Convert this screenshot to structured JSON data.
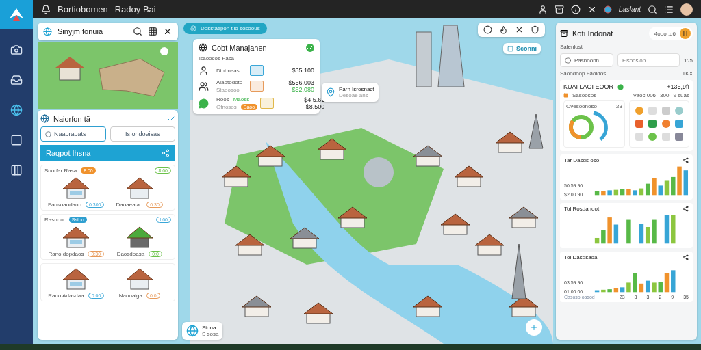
{
  "app": {
    "title": "Bortiobomen",
    "subtitle": "Radoy Bai",
    "account": "Laslant"
  },
  "search_card": {
    "title": "Sinyjm fonuia"
  },
  "location_card": {
    "title": "Naiorfon tä",
    "tabs": [
      {
        "label": "Naaoraoats",
        "selected": true
      },
      {
        "label": "Is ondoeisas",
        "selected": false
      }
    ],
    "header": "Raqpot Ihsna",
    "sections": [
      {
        "title": "Soorfar Rasa",
        "badge": "8:00",
        "tag": "8:00",
        "items": [
          {
            "label": "Faosoaodaoo",
            "tag": "0:300",
            "color": "#3aa7d8"
          },
          {
            "label": "Daoaeaiao",
            "tag": "0:30",
            "color": "#e79a5a"
          }
        ]
      },
      {
        "title": "Rasnbot",
        "badge": "Sstoo",
        "tag": "I:00",
        "items": [
          {
            "label": "Rano dopdaos",
            "tag": "0:30",
            "color": "#e79a5a"
          },
          {
            "label": "Daosdoasa",
            "tag": "0:0",
            "color": "#6cc24a"
          }
        ]
      },
      {
        "items": [
          {
            "label": "Raoo Adasdaa",
            "tag": "0:00",
            "color": "#3aa7d8"
          },
          {
            "label": "Naooaiga",
            "tag": "0:0",
            "color": "#e79a5a"
          }
        ]
      }
    ]
  },
  "layer_pill": "Dosstatipon tllo sosoous",
  "cost_card": {
    "title": "Cobt Manajanen",
    "subtitle": "Isaoocos Fasa",
    "rows": [
      {
        "kind": "person",
        "name": "Dinbnaas",
        "amount": "$35.100",
        "color": "#3aa7d8"
      },
      {
        "kind": "pair",
        "name": "Alaotodoto",
        "sub": "Staoosoo",
        "amount": "$556.003",
        "change": "$52,080",
        "color": "#e79a5a"
      },
      {
        "kind": "chat",
        "name": "Roos",
        "extra": "Maoss",
        "sub": "Ofnosos",
        "badge": "Saoo",
        "amount": "$4 5.61",
        "change": "$8.500",
        "color": "#e0b84a"
      }
    ]
  },
  "tooltip": {
    "title": "Parn Isrosnact",
    "subtitle": "Desoae ans"
  },
  "scene_badge": "Sconni",
  "map_badge": {
    "title": "Siona",
    "subtitle": "S sosa"
  },
  "right_panel": {
    "title": "Kotı Indonat",
    "pill": "4ooo :o6",
    "avatar": "H",
    "label": "Salenlost",
    "field_one": "Pasnoonn",
    "field_two": {
      "placeholder": "Fisoosiop",
      "count": "1’/5"
    },
    "section": "Saoodoop Faoidos",
    "section_tag": "TKX",
    "summary": {
      "title": "KUAI LAOI EOOR",
      "value": "+135,9fI",
      "legend": "Sasoosos",
      "stats": [
        "Vaoc 006",
        "300",
        "9 suas"
      ],
      "donut_title": "Ovesoonoso",
      "donut_count": "23"
    },
    "charts": [
      {
        "title": "Tar Dasds oso",
        "ticks": [
          "50.59.90",
          "$2,00.90"
        ]
      },
      {
        "title": "Tol Rosdanoot"
      },
      {
        "title": "Tol Dasdsaoa",
        "ticks": [
          "03,59.90",
          "01,00.00"
        ],
        "footer": "Casoso oasod",
        "footer_values": [
          "23",
          "3",
          "3",
          "2",
          "9",
          "35"
        ]
      }
    ]
  }
}
